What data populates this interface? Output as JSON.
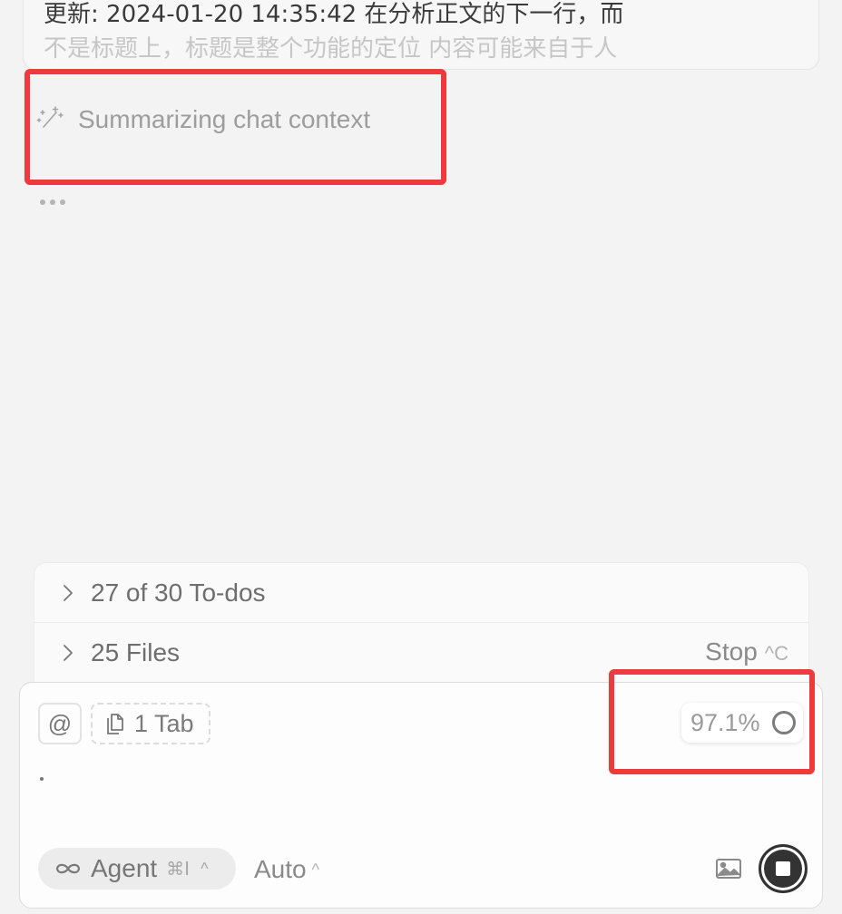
{
  "message": {
    "line1": "更新: 2024-01-20 14:35:42 在分析正文的下一行，而",
    "line2": "不是标题上，标题是整个功能的定位 内容可能来自于人"
  },
  "status": {
    "summary_text": "Summarizing chat context",
    "summary_icon": "sparkles-icon"
  },
  "panel": {
    "todos_label": "27 of 30 To-dos",
    "files_label": "25 Files",
    "stop_label": "Stop",
    "stop_shortcut": "^C"
  },
  "composer": {
    "mention_symbol": "@",
    "tab_chip_label": "1 Tab",
    "context_usage": "97.1%",
    "input_value": ".",
    "mode_label": "Agent",
    "mode_shortcut": "⌘I",
    "model_label": "Auto"
  },
  "colors": {
    "highlight": "#ee3a3d",
    "background": "#f3f3f3",
    "stop_button": "#333333"
  }
}
